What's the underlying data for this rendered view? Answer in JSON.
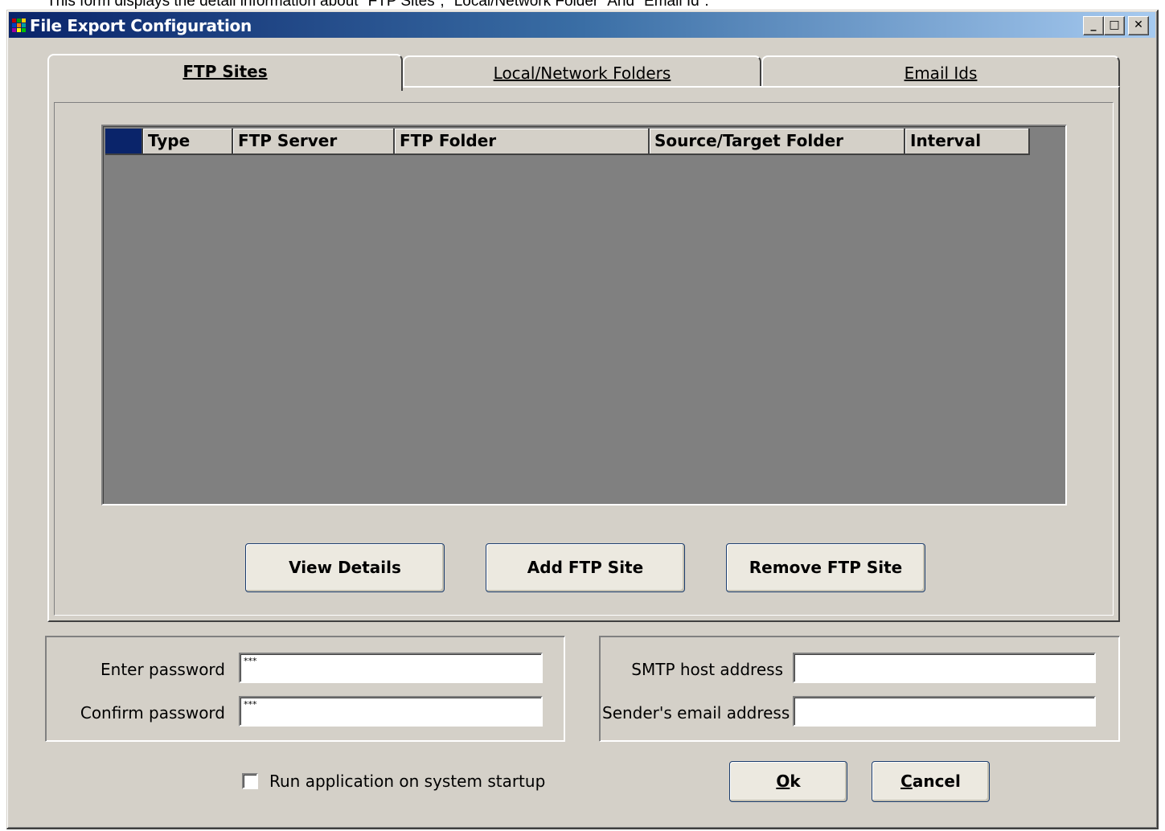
{
  "caption": "This form displays the detail information about \"FTP Sites\", \"Local/Network Folder\" And \"Email Id\".",
  "window": {
    "title": "File Export Configuration",
    "controls": {
      "minimize": "_",
      "maximize": "□",
      "close": "✕"
    }
  },
  "tabs": [
    {
      "label": "FTP Sites",
      "active": true
    },
    {
      "label": "Local/Network Folders",
      "active": false
    },
    {
      "label": "Email Ids",
      "active": false
    }
  ],
  "grid": {
    "columns": [
      "Type",
      "FTP Server",
      "FTP Folder",
      "Source/Target Folder",
      "Interval"
    ],
    "rows": []
  },
  "buttons": {
    "view_details": "View Details",
    "add_ftp_site": "Add FTP Site",
    "remove_ftp_site": "Remove FTP Site",
    "ok_mnemonic": "O",
    "ok_rest": "k",
    "cancel_mnemonic": "C",
    "cancel_rest": "ancel"
  },
  "password_group": {
    "enter_label": "Enter password",
    "enter_value": "***",
    "confirm_label": "Confirm password",
    "confirm_value": "***"
  },
  "smtp_group": {
    "host_label": "SMTP host address",
    "host_value": "",
    "sender_label": "Sender's email address",
    "sender_value": ""
  },
  "startup_checkbox": {
    "label": "Run application on system startup",
    "checked": false
  },
  "colors": {
    "titlebar_start": "#0a246a",
    "titlebar_end": "#a6caf0",
    "dialog_bg": "#d4d0c8",
    "grid_bg": "#808080"
  }
}
